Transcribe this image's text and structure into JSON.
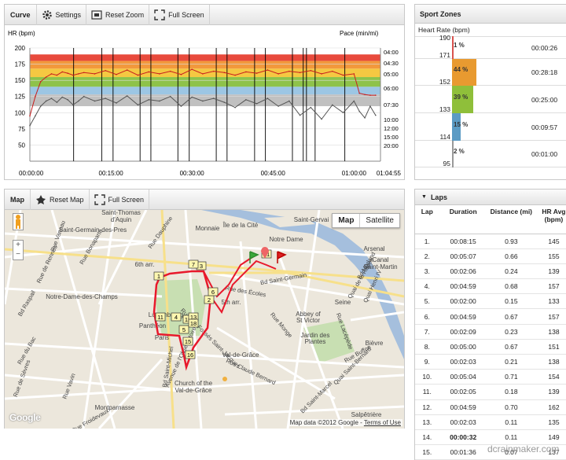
{
  "curve": {
    "title": "Curve",
    "settings_label": "Settings",
    "reset_zoom_label": "Reset Zoom",
    "full_screen_label": "Full Screen",
    "hr_axis_label": "HR (bpm)",
    "pace_axis_label": "Pace (min/mi)",
    "hr_ticks": [
      "200",
      "175",
      "150",
      "125",
      "100",
      "75",
      "50"
    ],
    "pace_ticks": [
      "04:00",
      "04:30",
      "05:00",
      "06:00",
      "07:30",
      "10:00",
      "12:00",
      "15:00",
      "20:00"
    ],
    "time_ticks": [
      "00:00:00",
      "00:15:00",
      "00:30:00",
      "00:45:00",
      "01:00:00",
      "01:04:55"
    ],
    "zone_colors": [
      "#e84a3c",
      "#f2983c",
      "#f5c842",
      "#8ec24a",
      "#9cc6e4",
      "#c0c0c0"
    ]
  },
  "chart_data": {
    "type": "line",
    "title": "",
    "xlabel": "",
    "ylabel": "HR (bpm)",
    "y2label": "Pace (min/mi)",
    "xlim": [
      "00:00:00",
      "01:04:55"
    ],
    "ylim": [
      25,
      200
    ],
    "grid": true,
    "series": [
      {
        "name": "",
        "x_minutes": [
          0,
          1,
          2,
          3,
          4,
          5,
          6,
          7,
          8,
          9,
          10,
          12,
          14,
          16,
          18,
          20,
          22,
          24,
          26,
          28,
          30,
          32,
          34,
          36,
          38,
          40,
          42,
          44,
          46,
          48,
          50,
          52,
          54,
          56,
          58,
          60,
          61,
          62,
          63,
          64
        ],
        "values": [
          95,
          125,
          148,
          155,
          160,
          158,
          163,
          161,
          158,
          160,
          162,
          160,
          165,
          159,
          166,
          158,
          163,
          160,
          164,
          159,
          167,
          160,
          164,
          162,
          158,
          163,
          161,
          166,
          160,
          164,
          162,
          165,
          160,
          164,
          158,
          160,
          130,
          128,
          127,
          127
        ]
      },
      {
        "name": "",
        "x_minutes": [
          0,
          1,
          2,
          3,
          4,
          5,
          6,
          7,
          8,
          9,
          10,
          12,
          14,
          16,
          18,
          20,
          22,
          24,
          26,
          28,
          30,
          32,
          34,
          36,
          38,
          40,
          42,
          44,
          46,
          48,
          50,
          52,
          54,
          56,
          58,
          60,
          61,
          62,
          63,
          64
        ],
        "values": [
          80,
          95,
          110,
          118,
          122,
          116,
          124,
          120,
          112,
          118,
          125,
          118,
          122,
          115,
          126,
          112,
          120,
          118,
          125,
          110,
          124,
          118,
          122,
          116,
          108,
          120,
          114,
          122,
          110,
          118,
          96,
          108,
          90,
          112,
          100,
          118,
          102,
          92,
          110,
          96
        ]
      }
    ],
    "markers_minutes": [
      8.1,
      13.3,
      15.4,
      20.4,
      22.4,
      27.4,
      29.5,
      34.5,
      36.5,
      41.6,
      43.6,
      48.6,
      50.6,
      51.2,
      52.8,
      58.3
    ]
  },
  "map": {
    "title": "Map",
    "reset_map_label": "Reset Map",
    "full_screen_label": "Full Screen",
    "map_button": "Map",
    "satellite_button": "Satellite",
    "attribution": "Map data ©2012 Google - ",
    "terms": "Terms of Use",
    "google_logo": "Google",
    "places": [
      {
        "text": "Saint-Thomas",
        "cls": "pl"
      },
      {
        "text": "d'Aquin",
        "cls": "pl"
      },
      {
        "text": "Saint-Germain-des-Pres",
        "cls": "pl"
      },
      {
        "text": "Monnaie",
        "cls": "pl"
      },
      {
        "text": "Île de la Cité",
        "cls": "pl"
      },
      {
        "text": "Saint-Gervai",
        "cls": "pl"
      },
      {
        "text": "Notre Dame",
        "cls": "pl"
      },
      {
        "text": "Arsenal",
        "cls": "pl"
      },
      {
        "text": "6th arr.",
        "cls": "pl"
      },
      {
        "text": "Notre-Dame-des-Champs",
        "cls": "pl"
      },
      {
        "text": "5th arr.",
        "cls": "pl"
      },
      {
        "text": "Panthéon",
        "cls": "pl"
      },
      {
        "text": "Abbey of",
        "cls": "pl"
      },
      {
        "text": "St Victor",
        "cls": "pl"
      },
      {
        "text": "Jardin des",
        "cls": "pl"
      },
      {
        "text": "Plantes",
        "cls": "pl"
      },
      {
        "text": "Bièvre",
        "cls": "pl"
      },
      {
        "text": "Val-de-Grâce",
        "cls": "pl"
      },
      {
        "text": "Church of the",
        "cls": "pl"
      },
      {
        "text": "Val-de-Grâce",
        "cls": "pl"
      },
      {
        "text": "Montparnasse",
        "cls": "pl"
      },
      {
        "text": "Salpêtrière",
        "cls": "pl"
      },
      {
        "text": "Seine",
        "cls": "pl"
      },
      {
        "text": "Rue Vaneau",
        "cls": "rd"
      },
      {
        "text": "Rue Bonaparte",
        "cls": "rd"
      },
      {
        "text": "Rue Dauphine",
        "cls": "rd"
      },
      {
        "text": "Bd Saint-Germain",
        "cls": "rd"
      },
      {
        "text": "Rue des Écoles",
        "cls": "rd"
      },
      {
        "text": "Rue Monge",
        "cls": "rd"
      },
      {
        "text": "Rue Buffon",
        "cls": "rd"
      },
      {
        "text": "Rue Claude Bernard",
        "cls": "rd"
      },
      {
        "text": "Rue Froidevaux",
        "cls": "rd"
      },
      {
        "text": "Quai Saint-Bernard",
        "cls": "rd"
      },
      {
        "text": "Bd Saint-Marcel",
        "cls": "rd"
      },
      {
        "text": "Quai de la Rapée",
        "cls": "rd"
      },
      {
        "text": "Bd Morland",
        "cls": "rd"
      },
      {
        "text": "Quai Henri IV",
        "cls": "rd"
      },
      {
        "text": "Canal",
        "cls": "pl"
      },
      {
        "text": "Saint-Martin",
        "cls": "pl"
      },
      {
        "text": "Luxembourg",
        "cls": "pl"
      },
      {
        "text": "Paris",
        "cls": "pl"
      },
      {
        "text": "Rue Vavin",
        "cls": "rd"
      },
      {
        "text": "Avenue de l'Observatoire",
        "cls": "rd"
      },
      {
        "text": "Bd Saint-Michel",
        "cls": "rd"
      },
      {
        "text": "Rue Lacépède",
        "cls": "rd"
      },
      {
        "text": "Rue du Bac",
        "cls": "rd"
      },
      {
        "text": "Rue de Rennes",
        "cls": "rd"
      },
      {
        "text": "Bd Raspail",
        "cls": "rd"
      },
      {
        "text": "Rue de Sèvres",
        "cls": "rd"
      },
      {
        "text": "Rue des Fossés Saint-Jacques",
        "cls": "rd"
      }
    ],
    "lap_markers": [
      "1",
      "2",
      "3",
      "4",
      "5",
      "6",
      "7",
      "11",
      "12",
      "13",
      "15",
      "16",
      "18",
      "21"
    ]
  },
  "zones": {
    "title": "Sport Zones",
    "subtitle": "Heart Rate (bpm)",
    "rows": [
      {
        "top": "190",
        "bottom": "171",
        "pct": "1 %",
        "time": "00:00:26",
        "color": "#d9534f",
        "bar_fraction": 0.02
      },
      {
        "top": "",
        "bottom": "152",
        "pct": "44 %",
        "time": "00:28:18",
        "color": "#e89a30",
        "bar_fraction": 0.44
      },
      {
        "top": "",
        "bottom": "133",
        "pct": "39 %",
        "time": "00:25:00",
        "color": "#8fbf3a",
        "bar_fraction": 0.39
      },
      {
        "top": "",
        "bottom": "114",
        "pct": "15 %",
        "time": "00:09:57",
        "color": "#5b9bc4",
        "bar_fraction": 0.15
      },
      {
        "top": "",
        "bottom": "95",
        "pct": "2 %",
        "time": "00:01:00",
        "color": "#999999",
        "bar_fraction": 0.02
      }
    ]
  },
  "laps": {
    "title": "Laps",
    "headers": [
      "Lap",
      "Duration",
      "Distance (mi)",
      "HR Avg (bpm)"
    ],
    "rows": [
      [
        "1.",
        "00:08:15",
        "0.93",
        "145"
      ],
      [
        "2.",
        "00:05:07",
        "0.66",
        "155"
      ],
      [
        "3.",
        "00:02:06",
        "0.24",
        "139"
      ],
      [
        "4.",
        "00:04:59",
        "0.68",
        "157"
      ],
      [
        "5.",
        "00:02:00",
        "0.15",
        "133"
      ],
      [
        "6.",
        "00:04:59",
        "0.67",
        "157"
      ],
      [
        "7.",
        "00:02:09",
        "0.23",
        "138"
      ],
      [
        "8.",
        "00:05:00",
        "0.67",
        "151"
      ],
      [
        "9.",
        "00:02:03",
        "0.21",
        "138"
      ],
      [
        "10.",
        "00:05:04",
        "0.71",
        "154"
      ],
      [
        "11.",
        "00:02:05",
        "0.18",
        "139"
      ],
      [
        "12.",
        "00:04:59",
        "0.70",
        "162"
      ],
      [
        "13.",
        "00:02:03",
        "0.11",
        "135"
      ],
      [
        "14.",
        "00:00:32",
        "0.11",
        "149"
      ],
      [
        "15.",
        "00:01:36",
        "0.07",
        "137"
      ]
    ],
    "bold_row": 13
  },
  "watermark": "dcrainmaker.com"
}
